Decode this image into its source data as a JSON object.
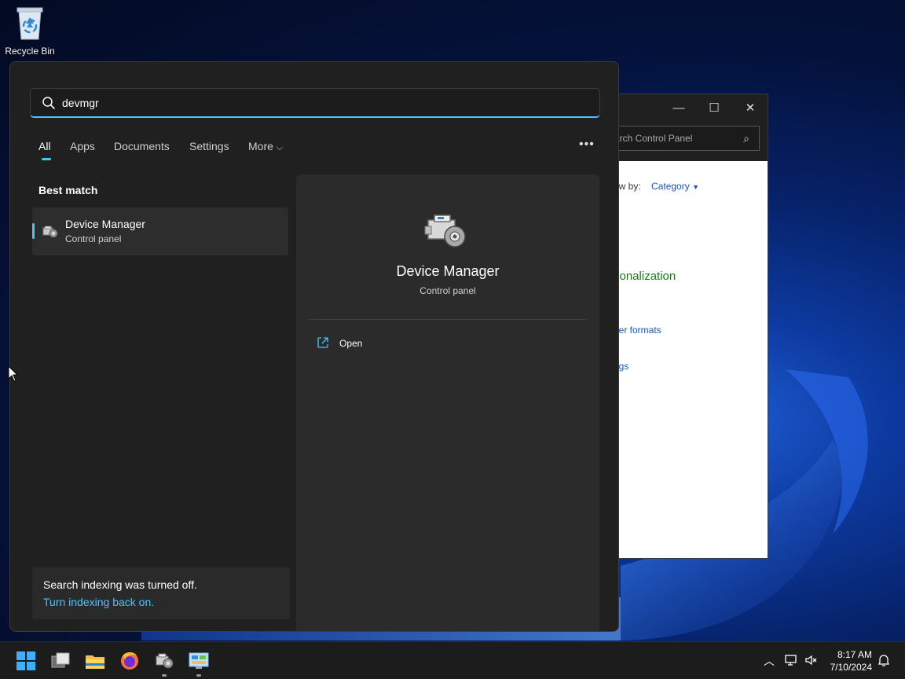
{
  "desktop": {
    "recycle_bin_label": "Recycle Bin"
  },
  "control_panel": {
    "search_placeholder": "arch Control Panel",
    "view_by_label": "ew by:",
    "view_by_value": "Category",
    "personalization_text": "sonalization",
    "number_formats_text": "ber formats",
    "settings_text": "ngs",
    "minimize_glyph": "—",
    "maximize_glyph": "☐",
    "close_glyph": "✕"
  },
  "search_panel": {
    "query": "devmgr",
    "tabs": [
      {
        "label": "All",
        "active": true
      },
      {
        "label": "Apps",
        "active": false
      },
      {
        "label": "Documents",
        "active": false
      },
      {
        "label": "Settings",
        "active": false
      },
      {
        "label": "More",
        "active": false
      }
    ],
    "more_chevron": "⌵",
    "options_glyph": "•••",
    "best_match_heading": "Best match",
    "best_match": {
      "title": "Device Manager",
      "subtitle": "Control panel",
      "icon": "device-manager-icon"
    },
    "notice": {
      "message": "Search indexing was turned off.",
      "link": "Turn indexing back on."
    },
    "detail": {
      "title": "Device Manager",
      "subtitle": "Control panel",
      "actions": [
        {
          "label": "Open",
          "icon": "open-external-icon"
        }
      ]
    },
    "accent_color": "#4cc2ff"
  },
  "taskbar": {
    "apps": [
      {
        "name": "start-button",
        "icon": "windows-logo-icon"
      },
      {
        "name": "task-view-button",
        "icon": "task-view-icon"
      },
      {
        "name": "file-explorer-button",
        "icon": "folder-icon"
      },
      {
        "name": "firefox-button",
        "icon": "firefox-icon"
      },
      {
        "name": "device-manager-taskbar-button",
        "icon": "device-manager-icon"
      },
      {
        "name": "control-panel-taskbar-button",
        "icon": "control-panel-icon"
      }
    ],
    "tray": {
      "chevron_glyph": "︿",
      "time": "8:17 AM",
      "date": "7/10/2024"
    }
  }
}
